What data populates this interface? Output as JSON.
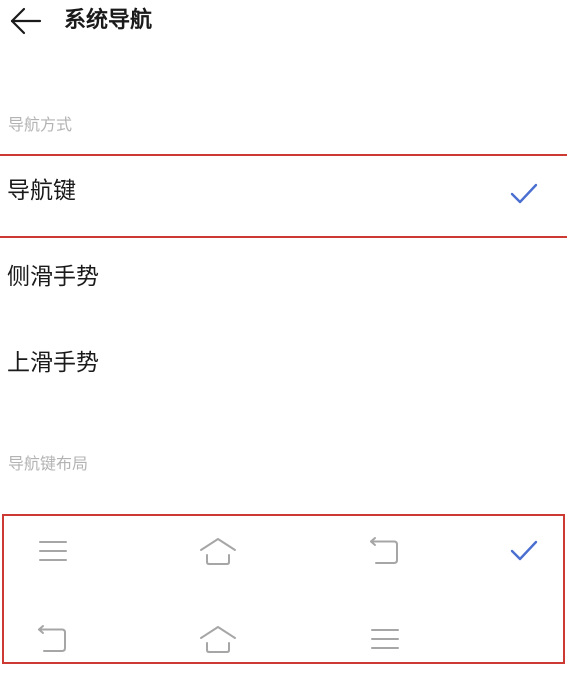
{
  "header": {
    "title": "系统导航"
  },
  "sections": {
    "nav_mode_label": "导航方式",
    "nav_layout_label": "导航键布局"
  },
  "nav_modes": [
    {
      "label": "导航键",
      "selected": true
    },
    {
      "label": "侧滑手势",
      "selected": false
    },
    {
      "label": "上滑手势",
      "selected": false
    }
  ],
  "nav_layouts": [
    {
      "buttons": [
        "menu-icon",
        "home-icon",
        "back-icon"
      ],
      "selected": true
    },
    {
      "buttons": [
        "back-icon",
        "home-icon",
        "menu-icon"
      ],
      "selected": false
    }
  ],
  "colors": {
    "accent": "#4a6fd1",
    "highlight_border": "#cc3a33",
    "section_label": "#b3b3b3",
    "icon_gray": "#a6a6a6"
  }
}
